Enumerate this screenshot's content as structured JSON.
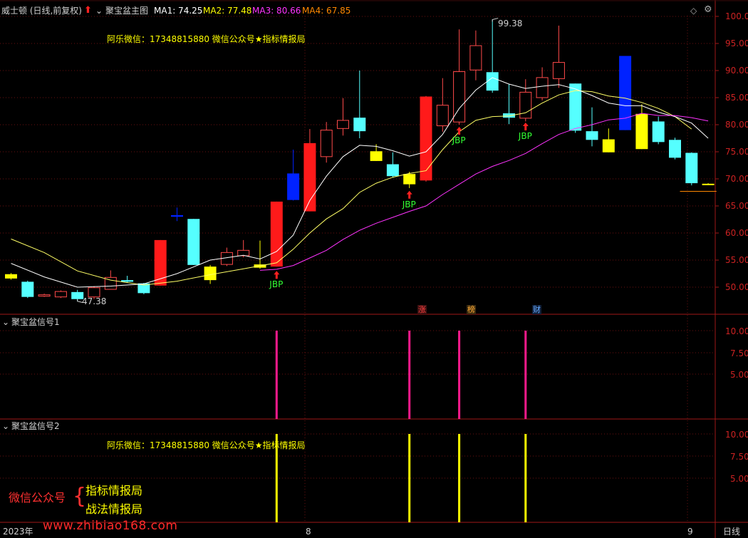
{
  "header": {
    "stock_title": "威士顿 (日线,前复权)",
    "indicator_name": "聚宝盆主图",
    "ma1": "MA1: 74.25",
    "ma2": "MA2: 77.48",
    "ma3": "MA3: 80.66",
    "ma4": "MA4: 67.85",
    "colors": {
      "ma1": "#ffffff",
      "ma2": "#ffff00",
      "ma3": "#ff33ff",
      "ma4": "#ff8800"
    }
  },
  "watermark_top": "阿乐微信：17348815880    微信公众号★指标情报局",
  "price_axis": [
    "100.0",
    "95.00",
    "90.00",
    "85.00",
    "80.00",
    "75.00",
    "70.00",
    "65.00",
    "60.00",
    "55.00",
    "50.00"
  ],
  "price_labels": {
    "high": "99.38",
    "low": "47.38"
  },
  "signals": {
    "jbp": "JBP"
  },
  "badges": {
    "zhang": "涨",
    "bang": "榜",
    "cai": "财"
  },
  "panel2": {
    "title": "聚宝盆信号1",
    "axis": [
      "10.00",
      "7.50",
      "5.00"
    ]
  },
  "panel3": {
    "title": "聚宝盆信号2",
    "axis": [
      "10.00",
      "7.50",
      "5.00"
    ],
    "watermark": "阿乐微信：17348815880    微信公众号★指标情报局"
  },
  "overlay": {
    "left": "微信公众号",
    "brace": "{",
    "line1": "指标情报局",
    "line2": "战法情报局",
    "site": "www.zhibiao168.com"
  },
  "timeline": {
    "year": "2023年",
    "month1": "8",
    "month2": "9",
    "period": "日线"
  },
  "chart_data": {
    "type": "candlestick",
    "y_range": [
      45.5,
      101.5
    ],
    "candles": [
      {
        "o": 51.6,
        "c": 52.4,
        "h": 52.6,
        "l": 51.4,
        "fill": "yellow"
      },
      {
        "o": 51.0,
        "c": 48.2,
        "h": 51.2,
        "l": 48.0,
        "fill": "cyan"
      },
      {
        "o": 48.4,
        "c": 48.6,
        "h": 48.8,
        "l": 48.2,
        "fill": "hollow_red"
      },
      {
        "o": 48.2,
        "c": 49.2,
        "h": 49.4,
        "l": 48.0,
        "fill": "hollow_red"
      },
      {
        "o": 49.1,
        "c": 47.8,
        "h": 49.5,
        "l": 47.4,
        "fill": "cyan"
      },
      {
        "o": 48.2,
        "c": 49.9,
        "h": 50.2,
        "l": 47.8,
        "fill": "hollow_red"
      },
      {
        "o": 49.6,
        "c": 51.8,
        "h": 53.1,
        "l": 49.6,
        "fill": "hollow_red"
      },
      {
        "o": 51.3,
        "c": 51.0,
        "h": 52.1,
        "l": 50.9,
        "fill": "cyan"
      },
      {
        "o": 50.7,
        "c": 48.9,
        "h": 50.8,
        "l": 48.7,
        "fill": "cyan"
      },
      {
        "o": 50.3,
        "c": 58.7,
        "h": 58.7,
        "l": 50.3,
        "fill": "red"
      },
      {
        "o": 63.0,
        "c": 63.3,
        "h": 64.7,
        "l": 62.2,
        "fill": "blue"
      },
      {
        "o": 62.6,
        "c": 54.1,
        "h": 62.6,
        "l": 54.1,
        "fill": "cyan"
      },
      {
        "o": 53.8,
        "c": 51.3,
        "h": 54.1,
        "l": 50.6,
        "fill": "yellow"
      },
      {
        "o": 54.2,
        "c": 56.4,
        "h": 57.3,
        "l": 53.9,
        "fill": "hollow_red"
      },
      {
        "o": 55.8,
        "c": 56.8,
        "h": 58.7,
        "l": 55.5,
        "fill": "hollow_red"
      },
      {
        "o": 54.2,
        "c": 53.6,
        "h": 58.6,
        "l": 53.4,
        "fill": "yellow"
      },
      {
        "o": 53.8,
        "c": 65.8,
        "h": 65.8,
        "l": 53.8,
        "fill": "red"
      },
      {
        "o": 71.0,
        "c": 66.1,
        "h": 75.4,
        "l": 66.0,
        "fill": "blue"
      },
      {
        "o": 64.0,
        "c": 76.6,
        "h": 79.2,
        "l": 64.0,
        "fill": "red"
      },
      {
        "o": 74.1,
        "c": 79.0,
        "h": 80.5,
        "l": 73.0,
        "fill": "hollow_red"
      },
      {
        "o": 79.3,
        "c": 80.8,
        "h": 84.9,
        "l": 78.0,
        "fill": "hollow_red"
      },
      {
        "o": 81.3,
        "c": 78.8,
        "h": 90.0,
        "l": 77.5,
        "fill": "cyan"
      },
      {
        "o": 75.1,
        "c": 73.3,
        "h": 76.4,
        "l": 73.3,
        "fill": "yellow"
      },
      {
        "o": 72.7,
        "c": 70.5,
        "h": 74.9,
        "l": 70.2,
        "fill": "cyan"
      },
      {
        "o": 70.9,
        "c": 69.0,
        "h": 71.3,
        "l": 68.3,
        "fill": "yellow"
      },
      {
        "o": 69.7,
        "c": 85.2,
        "h": 85.3,
        "l": 69.5,
        "fill": "red"
      },
      {
        "o": 79.8,
        "c": 83.6,
        "h": 88.6,
        "l": 78.7,
        "fill": "hollow_red"
      },
      {
        "o": 80.5,
        "c": 89.8,
        "h": 97.6,
        "l": 80.0,
        "fill": "hollow_red"
      },
      {
        "o": 90.1,
        "c": 94.6,
        "h": 97.4,
        "l": 88.2,
        "fill": "hollow_red"
      },
      {
        "o": 89.7,
        "c": 86.3,
        "h": 99.4,
        "l": 85.9,
        "fill": "cyan"
      },
      {
        "o": 82.1,
        "c": 81.3,
        "h": 87.5,
        "l": 80.1,
        "fill": "cyan"
      },
      {
        "o": 81.2,
        "c": 86.0,
        "h": 88.4,
        "l": 80.6,
        "fill": "hollow_red"
      },
      {
        "o": 85.0,
        "c": 88.7,
        "h": 90.6,
        "l": 84.5,
        "fill": "hollow_red"
      },
      {
        "o": 88.5,
        "c": 91.5,
        "h": 98.3,
        "l": 86.8,
        "fill": "hollow_red"
      },
      {
        "o": 87.6,
        "c": 78.9,
        "h": 87.6,
        "l": 78.5,
        "fill": "cyan"
      },
      {
        "o": 78.8,
        "c": 77.2,
        "h": 83.2,
        "l": 76.0,
        "fill": "cyan"
      },
      {
        "o": 77.3,
        "c": 74.9,
        "h": 79.3,
        "l": 74.9,
        "fill": "yellow"
      },
      {
        "o": 79.0,
        "c": 92.7,
        "h": 92.7,
        "l": 79.0,
        "fill": "blue"
      },
      {
        "o": 82.0,
        "c": 75.5,
        "h": 83.8,
        "l": 75.5,
        "fill": "yellow"
      },
      {
        "o": 80.6,
        "c": 76.8,
        "h": 81.5,
        "l": 76.4,
        "fill": "cyan"
      },
      {
        "o": 77.2,
        "c": 73.9,
        "h": 77.6,
        "l": 73.6,
        "fill": "cyan"
      },
      {
        "o": 74.8,
        "c": 69.2,
        "h": 74.9,
        "l": 68.8,
        "fill": "cyan"
      },
      {
        "o": 69.1,
        "c": 69.1,
        "h": 69.2,
        "l": 68.9,
        "fill": "yellow"
      }
    ],
    "ma_white": [
      [
        0,
        54.4
      ],
      [
        2,
        51.9
      ],
      [
        4,
        50.0
      ],
      [
        6,
        50.2
      ],
      [
        8,
        50.6
      ],
      [
        10,
        52.5
      ],
      [
        12,
        55.0
      ],
      [
        14,
        55.9
      ],
      [
        15,
        55.2
      ],
      [
        16,
        56.6
      ],
      [
        17,
        59.6
      ],
      [
        18,
        66.0
      ],
      [
        19,
        70.5
      ],
      [
        20,
        74.1
      ],
      [
        21,
        76.2
      ],
      [
        22,
        76.0
      ],
      [
        23,
        75.2
      ],
      [
        24,
        74.2
      ],
      [
        25,
        75.0
      ],
      [
        26,
        78.2
      ],
      [
        27,
        83.0
      ],
      [
        28,
        86.4
      ],
      [
        29,
        88.7
      ],
      [
        30,
        87.5
      ],
      [
        31,
        86.7
      ],
      [
        32,
        87.1
      ],
      [
        33,
        87.4
      ],
      [
        34,
        86.6
      ],
      [
        35,
        85.4
      ],
      [
        36,
        84.0
      ],
      [
        37,
        83.5
      ],
      [
        38,
        83.5
      ],
      [
        39,
        82.3
      ],
      [
        40,
        81.5
      ],
      [
        41,
        80.3
      ],
      [
        42,
        77.5
      ]
    ],
    "ma_yellow": [
      [
        0,
        58.9
      ],
      [
        2,
        56.4
      ],
      [
        4,
        53.0
      ],
      [
        6,
        51.3
      ],
      [
        8,
        50.4
      ],
      [
        10,
        51.1
      ],
      [
        12,
        52.3
      ],
      [
        14,
        53.4
      ],
      [
        16,
        54.5
      ],
      [
        17,
        57.0
      ],
      [
        18,
        60.0
      ],
      [
        19,
        62.6
      ],
      [
        20,
        64.5
      ],
      [
        21,
        67.5
      ],
      [
        22,
        69.2
      ],
      [
        23,
        70.3
      ],
      [
        24,
        71.0
      ],
      [
        25,
        71.5
      ],
      [
        26,
        75.4
      ],
      [
        27,
        78.7
      ],
      [
        28,
        80.8
      ],
      [
        29,
        81.5
      ],
      [
        30,
        81.6
      ],
      [
        31,
        82.2
      ],
      [
        32,
        84.0
      ],
      [
        33,
        85.5
      ],
      [
        34,
        86.3
      ],
      [
        35,
        86.1
      ],
      [
        36,
        85.3
      ],
      [
        37,
        84.9
      ],
      [
        38,
        84.1
      ],
      [
        39,
        83.0
      ],
      [
        40,
        81.5
      ],
      [
        41,
        79.2
      ]
    ],
    "ma_magenta": [
      [
        15,
        53.1
      ],
      [
        16,
        53.3
      ],
      [
        17,
        54.0
      ],
      [
        18,
        55.4
      ],
      [
        19,
        56.8
      ],
      [
        20,
        58.8
      ],
      [
        21,
        60.5
      ],
      [
        22,
        61.8
      ],
      [
        23,
        62.9
      ],
      [
        24,
        64.0
      ],
      [
        25,
        65.0
      ],
      [
        26,
        67.1
      ],
      [
        27,
        69.0
      ],
      [
        28,
        70.9
      ],
      [
        29,
        72.3
      ],
      [
        30,
        73.4
      ],
      [
        31,
        74.7
      ],
      [
        32,
        76.5
      ],
      [
        33,
        78.2
      ],
      [
        34,
        79.3
      ],
      [
        35,
        80.0
      ],
      [
        36,
        80.9
      ],
      [
        37,
        81.2
      ],
      [
        38,
        82.1
      ],
      [
        39,
        81.7
      ],
      [
        40,
        81.7
      ],
      [
        41,
        81.3
      ],
      [
        42,
        80.7
      ]
    ],
    "ma_orange": [
      [
        40.3,
        67.7
      ],
      [
        42.5,
        67.7
      ]
    ],
    "jbp_signals": [
      {
        "i": 16,
        "price": 53.0,
        "side": "below"
      },
      {
        "i": 24,
        "price": 67.8,
        "side": "below"
      },
      {
        "i": 27,
        "price": 79.6,
        "side": "above"
      },
      {
        "i": 31,
        "price": 80.4,
        "side": "above"
      }
    ],
    "signal1_bars": [
      16,
      24,
      27,
      31
    ],
    "signal2_bars": [
      16,
      24,
      27,
      31
    ],
    "signal_value": 10
  }
}
